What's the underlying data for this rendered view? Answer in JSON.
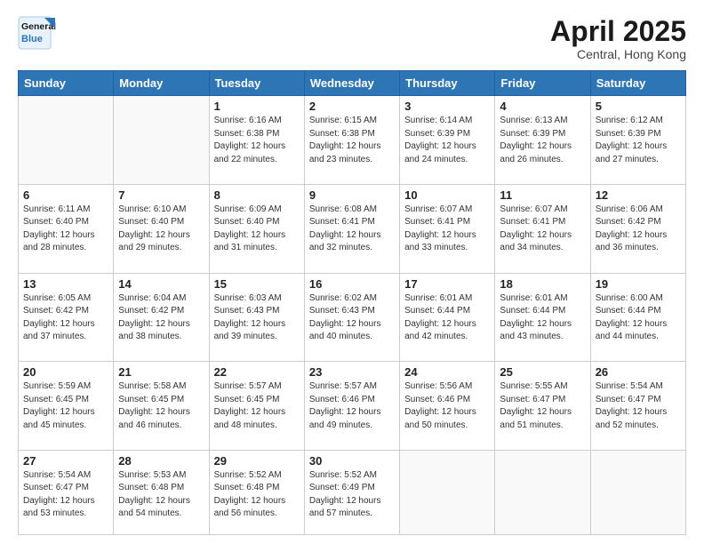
{
  "logo": {
    "line1": "General",
    "line2": "Blue"
  },
  "title": "April 2025",
  "location": "Central, Hong Kong",
  "weekdays": [
    "Sunday",
    "Monday",
    "Tuesday",
    "Wednesday",
    "Thursday",
    "Friday",
    "Saturday"
  ],
  "weeks": [
    [
      {
        "day": "",
        "info": ""
      },
      {
        "day": "",
        "info": ""
      },
      {
        "day": "1",
        "info": "Sunrise: 6:16 AM\nSunset: 6:38 PM\nDaylight: 12 hours and 22 minutes."
      },
      {
        "day": "2",
        "info": "Sunrise: 6:15 AM\nSunset: 6:38 PM\nDaylight: 12 hours and 23 minutes."
      },
      {
        "day": "3",
        "info": "Sunrise: 6:14 AM\nSunset: 6:39 PM\nDaylight: 12 hours and 24 minutes."
      },
      {
        "day": "4",
        "info": "Sunrise: 6:13 AM\nSunset: 6:39 PM\nDaylight: 12 hours and 26 minutes."
      },
      {
        "day": "5",
        "info": "Sunrise: 6:12 AM\nSunset: 6:39 PM\nDaylight: 12 hours and 27 minutes."
      }
    ],
    [
      {
        "day": "6",
        "info": "Sunrise: 6:11 AM\nSunset: 6:40 PM\nDaylight: 12 hours and 28 minutes."
      },
      {
        "day": "7",
        "info": "Sunrise: 6:10 AM\nSunset: 6:40 PM\nDaylight: 12 hours and 29 minutes."
      },
      {
        "day": "8",
        "info": "Sunrise: 6:09 AM\nSunset: 6:40 PM\nDaylight: 12 hours and 31 minutes."
      },
      {
        "day": "9",
        "info": "Sunrise: 6:08 AM\nSunset: 6:41 PM\nDaylight: 12 hours and 32 minutes."
      },
      {
        "day": "10",
        "info": "Sunrise: 6:07 AM\nSunset: 6:41 PM\nDaylight: 12 hours and 33 minutes."
      },
      {
        "day": "11",
        "info": "Sunrise: 6:07 AM\nSunset: 6:41 PM\nDaylight: 12 hours and 34 minutes."
      },
      {
        "day": "12",
        "info": "Sunrise: 6:06 AM\nSunset: 6:42 PM\nDaylight: 12 hours and 36 minutes."
      }
    ],
    [
      {
        "day": "13",
        "info": "Sunrise: 6:05 AM\nSunset: 6:42 PM\nDaylight: 12 hours and 37 minutes."
      },
      {
        "day": "14",
        "info": "Sunrise: 6:04 AM\nSunset: 6:42 PM\nDaylight: 12 hours and 38 minutes."
      },
      {
        "day": "15",
        "info": "Sunrise: 6:03 AM\nSunset: 6:43 PM\nDaylight: 12 hours and 39 minutes."
      },
      {
        "day": "16",
        "info": "Sunrise: 6:02 AM\nSunset: 6:43 PM\nDaylight: 12 hours and 40 minutes."
      },
      {
        "day": "17",
        "info": "Sunrise: 6:01 AM\nSunset: 6:44 PM\nDaylight: 12 hours and 42 minutes."
      },
      {
        "day": "18",
        "info": "Sunrise: 6:01 AM\nSunset: 6:44 PM\nDaylight: 12 hours and 43 minutes."
      },
      {
        "day": "19",
        "info": "Sunrise: 6:00 AM\nSunset: 6:44 PM\nDaylight: 12 hours and 44 minutes."
      }
    ],
    [
      {
        "day": "20",
        "info": "Sunrise: 5:59 AM\nSunset: 6:45 PM\nDaylight: 12 hours and 45 minutes."
      },
      {
        "day": "21",
        "info": "Sunrise: 5:58 AM\nSunset: 6:45 PM\nDaylight: 12 hours and 46 minutes."
      },
      {
        "day": "22",
        "info": "Sunrise: 5:57 AM\nSunset: 6:45 PM\nDaylight: 12 hours and 48 minutes."
      },
      {
        "day": "23",
        "info": "Sunrise: 5:57 AM\nSunset: 6:46 PM\nDaylight: 12 hours and 49 minutes."
      },
      {
        "day": "24",
        "info": "Sunrise: 5:56 AM\nSunset: 6:46 PM\nDaylight: 12 hours and 50 minutes."
      },
      {
        "day": "25",
        "info": "Sunrise: 5:55 AM\nSunset: 6:47 PM\nDaylight: 12 hours and 51 minutes."
      },
      {
        "day": "26",
        "info": "Sunrise: 5:54 AM\nSunset: 6:47 PM\nDaylight: 12 hours and 52 minutes."
      }
    ],
    [
      {
        "day": "27",
        "info": "Sunrise: 5:54 AM\nSunset: 6:47 PM\nDaylight: 12 hours and 53 minutes."
      },
      {
        "day": "28",
        "info": "Sunrise: 5:53 AM\nSunset: 6:48 PM\nDaylight: 12 hours and 54 minutes."
      },
      {
        "day": "29",
        "info": "Sunrise: 5:52 AM\nSunset: 6:48 PM\nDaylight: 12 hours and 56 minutes."
      },
      {
        "day": "30",
        "info": "Sunrise: 5:52 AM\nSunset: 6:49 PM\nDaylight: 12 hours and 57 minutes."
      },
      {
        "day": "",
        "info": ""
      },
      {
        "day": "",
        "info": ""
      },
      {
        "day": "",
        "info": ""
      }
    ]
  ]
}
